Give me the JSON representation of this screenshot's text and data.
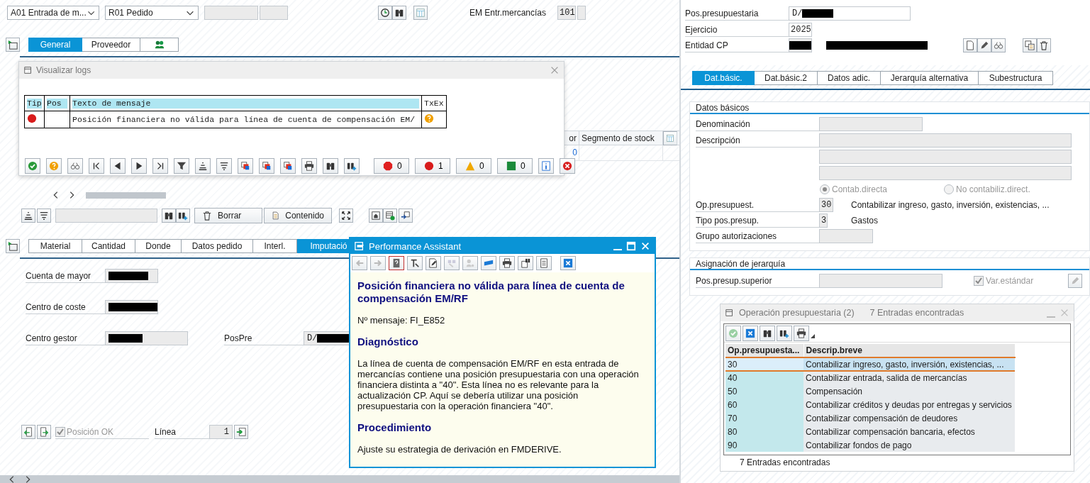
{
  "top_bar": {
    "action_select": "A01 Entrada de m...",
    "reference_select": "R01 Pedido",
    "movement_label": "EM Entr.mercancías",
    "movement_code": "101"
  },
  "header_tabs": [
    {
      "label": "General",
      "selected": true
    },
    {
      "label": "Proveedor",
      "selected": false
    }
  ],
  "item_grid": {
    "columns": [
      "or",
      "Segmento de stock"
    ],
    "cell": "0"
  },
  "grid_toolbar": {
    "buttons": [
      "Borrar",
      "Contenido"
    ]
  },
  "item_tabs": [
    {
      "label": "Material",
      "selected": false
    },
    {
      "label": "Cantidad",
      "selected": false
    },
    {
      "label": "Donde",
      "selected": false
    },
    {
      "label": "Datos pedido",
      "selected": false
    },
    {
      "label": "Interl.",
      "selected": false
    },
    {
      "label": "Imputació",
      "selected": true
    }
  ],
  "account_fields": [
    {
      "label": "Cuenta de mayor"
    },
    {
      "label": "Centro de coste"
    },
    {
      "label": "Centro gestor"
    }
  ],
  "pospre": {
    "label": "PosPre",
    "value": "D/"
  },
  "item_footer": {
    "position_ok": {
      "label": "Posición OK",
      "checked": true
    },
    "line_label": "Línea",
    "line_value": "1"
  },
  "logs_dialog": {
    "title": "Visualizar logs",
    "columns": [
      "Tip",
      "Pos",
      "Texto de mensaje",
      "TxEx"
    ],
    "rows": [
      {
        "kind": "error",
        "text": "Posición financiera no válida para línea de cuenta de compensación EM/"
      }
    ],
    "counters": [
      {
        "kind": "stop",
        "count": "0"
      },
      {
        "kind": "error",
        "count": "1"
      },
      {
        "kind": "warning",
        "count": "0"
      },
      {
        "kind": "success",
        "count": "0"
      }
    ]
  },
  "performance_assistant": {
    "title": "Performance Assistant",
    "heading": "Posición financiera no válida para línea de cuenta de compensación EM/RF",
    "message_number": "Nº mensaje: FI_E852",
    "sections": [
      {
        "heading": "Diagnóstico",
        "text": "La línea de cuenta de compensación EM/RF en esta entrada de mercancías contiene una posición presupuestaria con una operación financiera distinta a \"40\". Esta línea no es relevante para la actualización CP. Aquí se debería utilizar una posición presupuestaria con la operación financiera \"40\"."
      },
      {
        "heading": "Procedimiento",
        "text": "Ajuste su estrategia de derivación en FMDERIVE."
      }
    ]
  },
  "budget_item": {
    "position_label": "Pos.presupuestaria",
    "position_value": "D/",
    "year_label": "Ejercicio",
    "year_value": "2025",
    "entity_label": "Entidad CP"
  },
  "detail_tabs": [
    {
      "label": "Dat.básic.",
      "selected": true
    },
    {
      "label": "Dat.básic.2",
      "selected": false
    },
    {
      "label": "Datos adic.",
      "selected": false
    },
    {
      "label": "Jerarquía alternativa",
      "selected": false
    },
    {
      "label": "Subestructura",
      "selected": false
    }
  ],
  "basic_data": {
    "title": "Datos básicos",
    "name_label": "Denominación",
    "description_label": "Descripción",
    "posting_options": [
      {
        "label": "Contab.directa",
        "selected": true
      },
      {
        "label": "No contabiliz.direct.",
        "selected": false
      }
    ],
    "operation_label": "Op.presupuest.",
    "operation_value": "30",
    "operation_text": "Contabilizar ingreso, gasto, inversión, existencias, ...",
    "type_label": "Tipo pos.presup.",
    "type_value": "3",
    "type_text": "Gastos",
    "auth_label": "Grupo autorizaciones"
  },
  "hierarchy": {
    "title": "Asignación de jerarquía",
    "superior_label": "Pos.presup.superior",
    "standard_variant": {
      "label": "Var.estándar",
      "checked": true
    }
  },
  "value_help": {
    "title": "Operación presupuestaria (2)",
    "subtitle": "7 Entradas encontradas",
    "columns": [
      "Op.presupuesta...",
      "Descrip.breve"
    ],
    "rows": [
      {
        "code": "30",
        "text": "Contabilizar ingreso, gasto, inversión, existencias, ...",
        "selected": true
      },
      {
        "code": "40",
        "text": "Contabilizar entrada, salida de mercancías",
        "selected": false
      },
      {
        "code": "50",
        "text": "Compensación",
        "selected": false
      },
      {
        "code": "60",
        "text": "Contabilizar créditos y deudas por entregas y servicios",
        "selected": false
      },
      {
        "code": "70",
        "text": "Contabilizar compensación de deudores",
        "selected": false
      },
      {
        "code": "80",
        "text": "Contabilizar compensación bancaria, efectos",
        "selected": false
      },
      {
        "code": "90",
        "text": "Contabilizar fondos de pago",
        "selected": false
      }
    ],
    "status": "7 Entradas encontradas"
  }
}
